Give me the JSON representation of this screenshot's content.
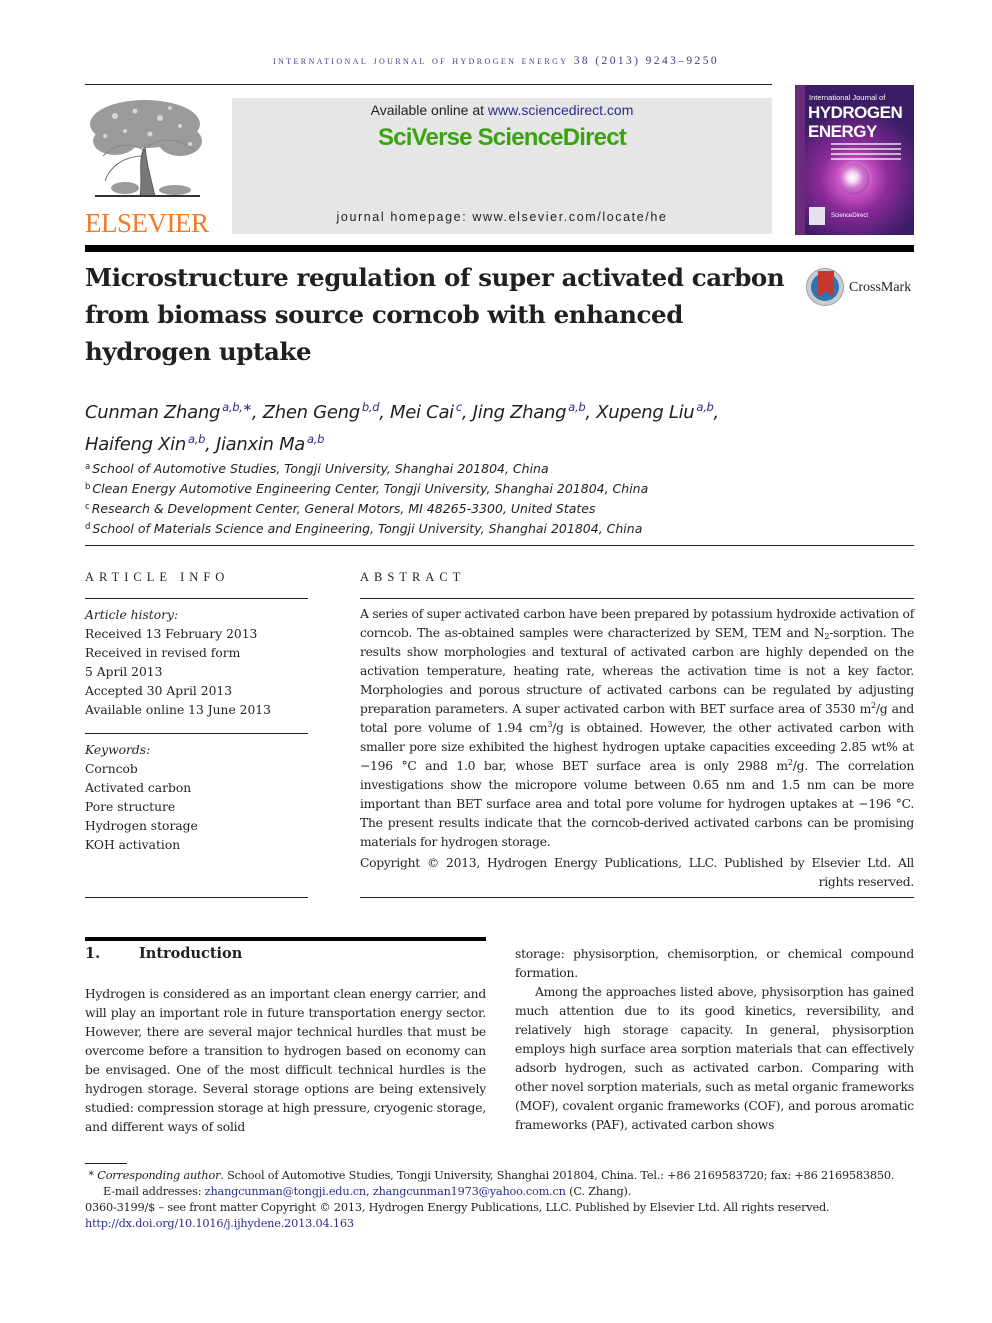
{
  "header": {
    "journal_line": "INTERNATIONAL JOURNAL OF HYDROGEN ENERGY 38 (2013) 9243–9250",
    "publisher_logo_word": "ELSEVIER",
    "available_online_prefix": "Available online at ",
    "available_online_link": "www.sciencedirect.com",
    "brand": "SciVerse ScienceDirect",
    "homepage": "journal homepage: www.elsevier.com/locate/he",
    "cover": {
      "subtitle": "International Journal of",
      "title_line1": "HYDROGEN",
      "title_line2": "ENERGY",
      "footer": "ScienceDirect"
    },
    "colors": {
      "elsevier_orange": "#f47b20",
      "sciencedirect_green": "#3aa310",
      "link_blue": "#2c2c8f",
      "banner_gray": "#e6e6e6"
    }
  },
  "article": {
    "title": "Microstructure regulation of super activated carbon from biomass source corncob with enhanced hydrogen uptake",
    "crossmark_label": "CrossMark",
    "authors": [
      {
        "name": "Cunman Zhang",
        "sup": "a,b,∗",
        "sep": ", "
      },
      {
        "name": "Zhen Geng",
        "sup": "b,d",
        "sep": ", "
      },
      {
        "name": "Mei Cai",
        "sup": "c",
        "sep": ", "
      },
      {
        "name": "Jing Zhang",
        "sup": "a,b",
        "sep": ", "
      },
      {
        "name": "Xupeng Liu",
        "sup": "a,b",
        "sep": ","
      },
      {
        "name": "Haifeng Xin",
        "sup": "a,b",
        "sep": ", "
      },
      {
        "name": "Jianxin Ma",
        "sup": "a,b",
        "sep": ""
      }
    ],
    "affiliations": [
      {
        "key": "a",
        "text": "School of Automotive Studies, Tongji University, Shanghai 201804, China"
      },
      {
        "key": "b",
        "text": "Clean Energy Automotive Engineering Center, Tongji University, Shanghai 201804, China"
      },
      {
        "key": "c",
        "text": "Research & Development Center, General Motors, MI 48265-3300, United States"
      },
      {
        "key": "d",
        "text": "School of Materials Science and Engineering, Tongji University, Shanghai 201804, China"
      }
    ]
  },
  "article_info": {
    "heading": "ARTICLE INFO",
    "history_label": "Article history:",
    "history": [
      "Received 13 February 2013",
      "Received in revised form",
      "5 April 2013",
      "Accepted 30 April 2013",
      "Available online 13 June 2013"
    ],
    "keywords_label": "Keywords:",
    "keywords": [
      "Corncob",
      "Activated carbon",
      "Pore structure",
      "Hydrogen storage",
      "KOH activation"
    ]
  },
  "abstract": {
    "heading": "ABSTRACT",
    "p1": "A series of super activated carbon have been prepared by potassium hydroxide activation of corncob. The as-obtained samples were characterized by SEM, TEM and N",
    "p1_sub": "2",
    "p2": "-sorption. The results show morphologies and textural of activated carbon are highly depended on the activation temperature, heating rate, whereas the activation time is not a key factor. Morphologies and porous structure of activated carbons can be regulated by adjusting preparation parameters. A super activated carbon with BET surface area of 3530 m",
    "p2_sup": "2",
    "p3": "/g and total pore volume of 1.94 cm",
    "p3_sup": "3",
    "p4": "/g is obtained. However, the other activated carbon with smaller pore size exhibited the highest hydrogen uptake capacities exceeding 2.85 wt% at −196 °C and 1.0 bar, whose BET surface area is only 2988 m",
    "p4_sup": "2",
    "p5": "/g. The correlation investigations show the micropore volume between 0.65 nm and 1.5 nm can be more important than BET surface area and total pore volume for hydrogen uptakes at −196 °C. The present results indicate that the corncob-derived activated carbons can be promising materials for hydrogen storage.",
    "copyright": "Copyright © 2013, Hydrogen Energy Publications, LLC. Published by Elsevier Ltd. All rights reserved."
  },
  "introduction": {
    "number": "1.",
    "heading": "Introduction",
    "left_text": "Hydrogen is considered as an important clean energy carrier, and will play an important role in future transportation energy sector. However, there are several major technical hurdles that must be overcome before a transition to hydrogen based on economy can be envisaged. One of the most difficult technical hurdles is the hydrogen storage. Several storage options are being extensively studied: compression storage at high pressure, cryogenic storage, and different ways of solid",
    "right_text_1": "storage: physisorption, chemisorption, or chemical compound formation.",
    "right_text_2": "Among the approaches listed above, physisorption has gained much attention due to its good kinetics, reversibility, and relatively high storage capacity. In general, physisorption employs high surface area sorption materials that can effectively adsorb hydrogen, such as activated carbon. Comparing with other novel sorption materials, such as metal organic frameworks (MOF), covalent organic frameworks (COF), and porous aromatic frameworks (PAF), activated carbon shows"
  },
  "footnotes": {
    "corr_mark": "*",
    "corr_label": "Corresponding author",
    "corr_text": ". School of Automotive Studies, Tongji University, Shanghai 201804, China. Tel.: +86 2169583720; fax: +86 2169583850.",
    "email_label": "E-mail addresses: ",
    "email1": "zhangcunman@tongji.edu.cn",
    "email_sep": ", ",
    "email2": "zhangcunman1973@yahoo.com.cn",
    "email_suffix": " (C. Zhang).",
    "issn_line": "0360-3199/$ – see front matter Copyright © 2013, Hydrogen Energy Publications, LLC. Published by Elsevier Ltd. All rights reserved.",
    "doi": "http://dx.doi.org/10.1016/j.ijhydene.2013.04.163"
  }
}
